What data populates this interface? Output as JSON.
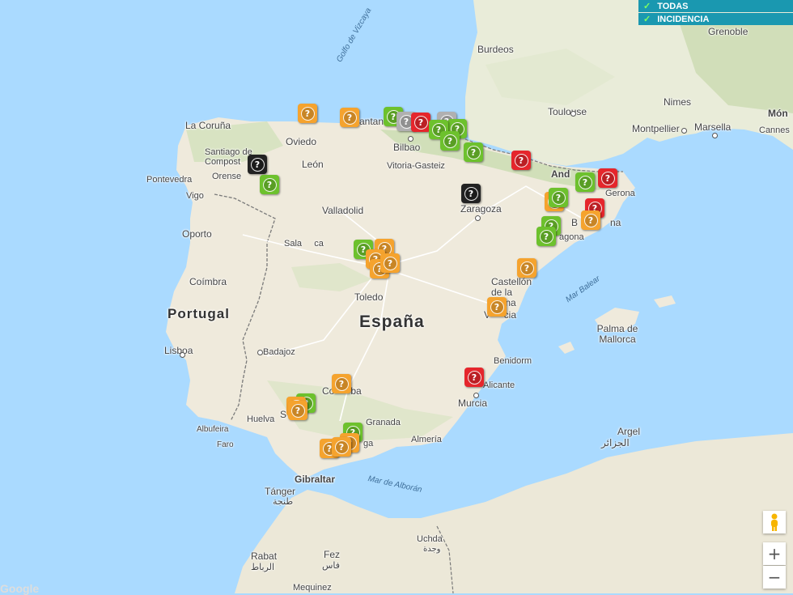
{
  "legend": {
    "items": [
      {
        "label": "TODAS",
        "checked": true
      },
      {
        "label": "INCIDENCIA",
        "checked": true
      }
    ]
  },
  "map": {
    "labels": {
      "golfo_vizcaya": "Golfo de Vizcaya",
      "burdeos": "Burdeos",
      "grenoble": "Grenoble",
      "monaco": "Món",
      "toulouse": "Toulouse",
      "nimes": "Nimes",
      "montpellier": "Montpellier",
      "marsella": "Marsella",
      "cannes": "Cannes",
      "la_coruna": "La Coruña",
      "oviedo": "Oviedo",
      "santander": "antan",
      "bilbao": "Bilbao",
      "vitoria": "Vitoria-Gasteiz",
      "santiago": "Santiago de Compost",
      "pontevedra": "Pontevedra",
      "orense": "Orense",
      "vigo": "Vigo",
      "leon": "León",
      "andorra": "And",
      "girona": "Gerona",
      "zaragoza": "Zaragoza",
      "valladolid": "Valladolid",
      "barcelona": "B",
      "barcelona2": "na",
      "tarragona": "agona",
      "oporto": "Oporto",
      "salamanca": "Sala     ca",
      "portugal": "Portugal",
      "coimbra": "Coímbra",
      "castellon": "Castellón de la Plana",
      "mar_balear": "Mar Balear",
      "toledo": "Toledo",
      "espana": "España",
      "valencia": "V     cia",
      "palma": "Palma de Mallorca",
      "lisboa": "Lisboa",
      "badajoz": "Badajoz",
      "benidorm": "Benidorm",
      "alicante": "Alicante",
      "cordoba": "Co      ba",
      "murcia": "Murcia",
      "huelva": "Huelva",
      "sevilla": "S",
      "albufeira": "Albufeira",
      "faro": "Faro",
      "granada": "Granada",
      "almeria": "Almería",
      "malaga": "ga",
      "argel": "Argel",
      "argel_ar": "الجزائر",
      "gibraltar": "Gibraltar",
      "mar_alboran": "Mar de Alborán",
      "tanger": "Tánger",
      "tanger_ar": "طنجة",
      "uchda": "Uchda",
      "uchda_ar": "وجدة",
      "rabat": "Rabat",
      "rabat_ar": "الرباط",
      "fez": "Fez",
      "fez_ar": "فاس",
      "mequinez": "Mequinez"
    },
    "markers": [
      {
        "status": "incidence",
        "color": "#f5a32e"
      },
      {
        "status": "incidence",
        "color": "#f5a32e"
      },
      {
        "status": "ok",
        "color": "#6dc12d"
      },
      {
        "status": "unknown",
        "color": "#b0b0b0"
      },
      {
        "status": "alert",
        "color": "#e5262c"
      },
      {
        "status": "unknown",
        "color": "#b0b0b0"
      },
      {
        "status": "ok",
        "color": "#6dc12d"
      },
      {
        "status": "ok",
        "color": "#6dc12d"
      },
      {
        "status": "ok",
        "color": "#6dc12d"
      },
      {
        "status": "offline",
        "color": "#222222"
      },
      {
        "status": "ok",
        "color": "#6dc12d"
      },
      {
        "status": "alert",
        "color": "#e5262c"
      },
      {
        "status": "offline",
        "color": "#222222"
      },
      {
        "status": "ok",
        "color": "#6dc12d"
      },
      {
        "status": "alert",
        "color": "#e5262c"
      },
      {
        "status": "ok",
        "color": "#6dc12d"
      },
      {
        "status": "incidence",
        "color": "#f5a32e"
      },
      {
        "status": "alert",
        "color": "#e5262c"
      },
      {
        "status": "incidence",
        "color": "#f5a32e"
      },
      {
        "status": "ok",
        "color": "#6dc12d"
      },
      {
        "status": "ok",
        "color": "#6dc12d"
      },
      {
        "status": "ok",
        "color": "#6dc12d"
      },
      {
        "status": "ok",
        "color": "#6dc12d"
      },
      {
        "status": "incidence",
        "color": "#f5a32e"
      },
      {
        "status": "incidence",
        "color": "#f5a32e"
      },
      {
        "status": "incidence",
        "color": "#f5a32e"
      },
      {
        "status": "incidence",
        "color": "#f5a32e"
      },
      {
        "status": "incidence",
        "color": "#f5a32e"
      },
      {
        "status": "incidence",
        "color": "#f5a32e"
      },
      {
        "status": "alert",
        "color": "#e5262c"
      },
      {
        "status": "incidence",
        "color": "#f5a32e"
      },
      {
        "status": "ok",
        "color": "#6dc12d"
      },
      {
        "status": "incidence",
        "color": "#f5a32e"
      },
      {
        "status": "incidence",
        "color": "#f5a32e"
      },
      {
        "status": "ok",
        "color": "#6dc12d"
      },
      {
        "status": "incidence",
        "color": "#f5a32e"
      },
      {
        "status": "incidence",
        "color": "#f5a32e"
      },
      {
        "status": "incidence",
        "color": "#f5a32e"
      }
    ],
    "marker_glyph": "?"
  },
  "controls": {
    "zoom_in": "+",
    "zoom_out": "−",
    "pegman_icon": "pegman-icon"
  },
  "colors": {
    "water": "#aadaff",
    "land": "#f1efe8",
    "legend_bg": "#1a98b0"
  },
  "attribution": {
    "logo": "Google"
  }
}
